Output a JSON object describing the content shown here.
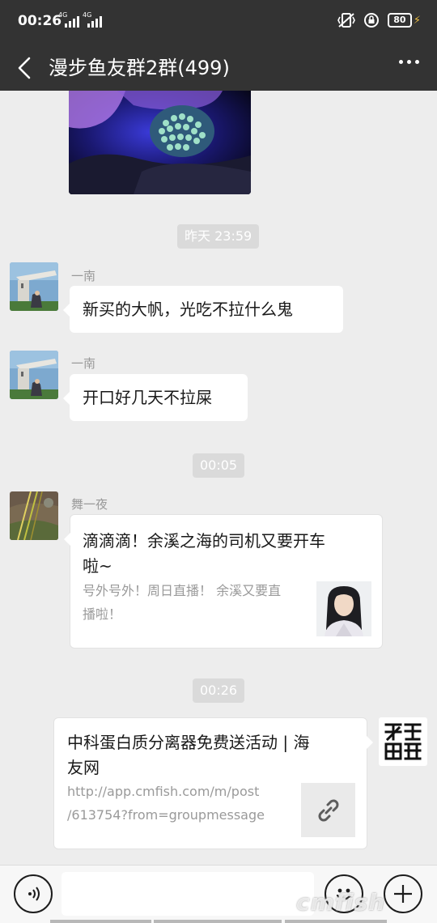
{
  "status_bar": {
    "time": "00:26",
    "network_1": "4G",
    "network_2": "4G",
    "battery": "80",
    "icons": [
      "vibrate-icon",
      "lock-rotation-icon",
      "charging-icon"
    ]
  },
  "header": {
    "title": "漫步鱼友群2群(499)",
    "icons": [
      "back-icon",
      "more-icon"
    ]
  },
  "messages": {
    "time_1": "昨天 23:59",
    "msg1": {
      "sender": "一南",
      "text": "新买的大帆，光吃不拉什么鬼"
    },
    "msg2": {
      "sender": "一南",
      "text": "开口好几天不拉屎"
    },
    "time_2": "00:05",
    "msg3": {
      "sender": "舞一夜",
      "title_line1": "滴滴滴！余溪之海的司机又要开车",
      "title_line2": "啦~",
      "desc_line1": "号外号外！周日直播！ 余溪又要直",
      "desc_line2": "播啦！"
    },
    "time_3": "00:26",
    "msg4": {
      "title_line1": "中科蛋白质分离器免费送活动 | 海",
      "title_line2": "友网",
      "url_line1": "http://app.cmfish.com/m/post",
      "url_line2": "/613754?from=groupmessage"
    }
  },
  "input_bar": {
    "icons": [
      "voice-icon",
      "emoji-icon",
      "plus-icon"
    ]
  },
  "watermark": "cmfish"
}
